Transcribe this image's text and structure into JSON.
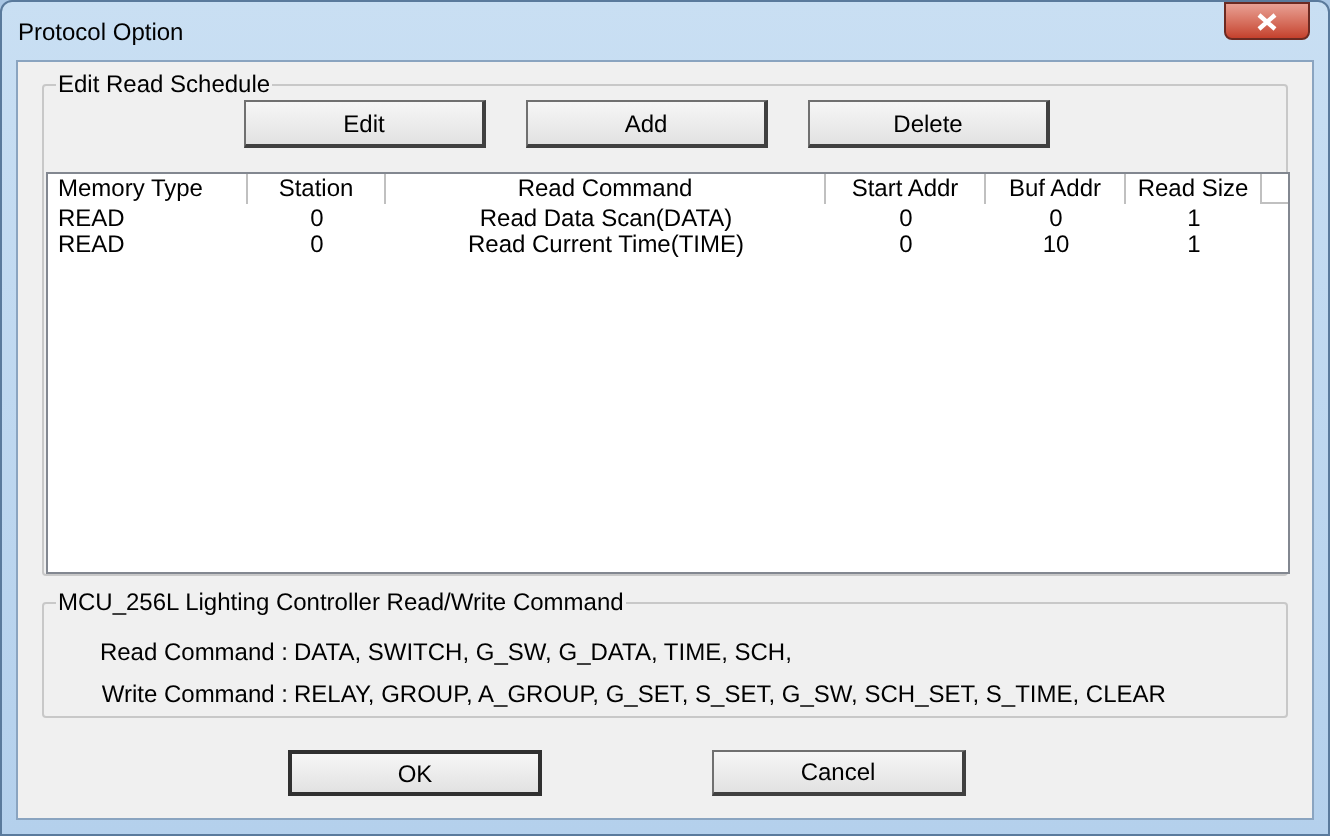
{
  "window": {
    "title": "Protocol Option"
  },
  "schedule": {
    "title": "Edit Read Schedule",
    "buttons": [
      "Edit",
      "Add",
      "Delete"
    ],
    "columns": [
      "Memory Type",
      "Station",
      "Read Command",
      "Start Addr",
      "Buf Addr",
      "Read Size"
    ],
    "rows": [
      [
        "READ",
        "0",
        "Read Data Scan(DATA)",
        "0",
        "0",
        "1"
      ],
      [
        "READ",
        "0",
        "Read Current Time(TIME)",
        "0",
        "10",
        "1"
      ]
    ]
  },
  "commands": {
    "title": "MCU_256L Lighting Controller Read/Write Command",
    "lines": [
      {
        "label": "Read Command :",
        "value": "DATA, SWITCH, G_SW, G_DATA, TIME, SCH,"
      },
      {
        "label": "Write Command :",
        "value": "RELAY, GROUP, A_GROUP, G_SET, S_SET, G_SW, SCH_SET, S_TIME, CLEAR"
      }
    ]
  },
  "buttons": [
    {
      "label": "OK",
      "default": true
    },
    {
      "label": "Cancel",
      "default": false
    }
  ]
}
